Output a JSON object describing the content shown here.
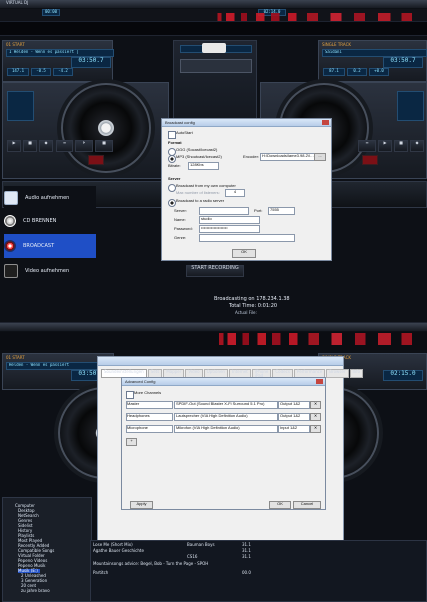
{
  "top": {
    "title_left": "VIRTUAL DJ",
    "time_a": "00:00",
    "time_b": "02:14.0",
    "search_hint": "search"
  },
  "deck_screen_1": {
    "left_deck": {
      "header": "01 START",
      "title": "1 Helden - Wenn es passiert |",
      "time": "03:50.7",
      "bpm": "147.1",
      "pitch": "-0.5",
      "gain": "-4.2",
      "deck_label": "1"
    },
    "right_deck": {
      "header": "SINGLE TRACK",
      "title": "Saidani",
      "time": "03:50.7",
      "bpm": "87.1",
      "pitch": "0.2",
      "gain": "+0.0",
      "deck_label": "2"
    },
    "center": {
      "broadcast_button": "START RECORDING",
      "broadcast_status": "Broadcasting on 178.234.1.38",
      "total_time_label": "Total Time: 0:01:20",
      "actual_file_label": "Actual File:",
      "menu_items": [
        {
          "label": "Audio aufnehmen",
          "icon": "cassette-icon"
        },
        {
          "label": "CD BRENNEN",
          "icon": "cd-icon"
        },
        {
          "label": "BROADCAST",
          "icon": "broadcast-icon"
        },
        {
          "label": "Video aufnehmen",
          "icon": "video-icon"
        }
      ]
    },
    "dialog": {
      "title": "Broadcast config",
      "autostart_label": "AutoStart",
      "format_label": "Format",
      "format_ogg": "OGG (Socast/Icecast2)",
      "format_mp3": "MP3 (Shoutcast/Icecast2)",
      "encoder_label": "Encoder:",
      "encoder_value": "H:\\Downloads\\lame3.98.2\\lame",
      "bitrate_label": "Bitrate:",
      "bitrate_value": "128Kbs",
      "server_label": "Server",
      "broadcast_own": "Broadcast from my own computer",
      "max_listeners_label": "Max number of listeners:",
      "max_listeners_value": "4",
      "broadcast_radio": "Broadcast to a radio server",
      "server_field_label": "Server:",
      "server_value": "",
      "port_label": "Port:",
      "port_value": "7555",
      "name_label": "Name:",
      "name_value": "studio",
      "password_label": "Password:",
      "password_value": "•••••••••••••••••••",
      "genre_label": "Genre:",
      "genre_value": "",
      "ok_button": "OK"
    }
  },
  "deck_screen_2": {
    "left_deck": {
      "header": "01 START",
      "title": "Helden - Wenn es passiert",
      "time": "03:50.7",
      "bpm": "143.1",
      "pitch": "-1.5",
      "gain": "-4.2"
    },
    "right_deck": {
      "header": "SINGLE TRACK",
      "title": "02:15.0",
      "time": "02:15.0",
      "bpm": "87.1",
      "pitch": "0.2",
      "gain": "+0.0"
    },
    "tabs": [
      "Soundeinstellungen",
      "Sets",
      "Mapper",
      "Video",
      "Optionen",
      "Internet",
      "iPhone iPad",
      "Codecs",
      "Performance",
      "Browser",
      "Info"
    ],
    "advanced_dialog": {
      "title": "Advanced Config",
      "more_channels": "More Channels",
      "rows": [
        {
          "role": "Master",
          "device": "SPDIF-Out (Sound Blaster X-Fi Surround 5.1 Pro)",
          "output": "Output 1&2"
        },
        {
          "role": "Headphones",
          "device": "Lautsprecher (VIA High Definition Audio)",
          "output": "Output 1&2"
        },
        {
          "role": "Microphone",
          "device": "Mikrofon (VIA High Definition Audio)",
          "output": "Input 1&2"
        }
      ],
      "add_button": "+",
      "apply_button": "Apply",
      "ok_button": "OK",
      "cancel_button": "Cancel",
      "outer_ok": "OK"
    },
    "browser": {
      "folders": [
        "Computer",
        "Desktop",
        "NetSearch",
        "Genres",
        "Sidelist",
        "History",
        "Playlists",
        "Most Played",
        "Recently Added",
        "Compatible Songs",
        "Virtual Folder",
        "Pepeno Videos",
        "Pepeno Musik",
        "Musik (E:)",
        "2 Unleashed",
        "3 Generation",
        "20 cent",
        "zu jahre bravo"
      ],
      "tracks": [
        {
          "title": "Lose Me (Short Mix)",
          "artist": "Bauman Boys",
          "bpm": "31.1"
        },
        {
          "title": "Agathe Bauer Geschichte",
          "artist": "",
          "bpm": "31.1"
        },
        {
          "title": "Mountain Boys",
          "artist": "CS16",
          "bpm": "31.1"
        }
      ],
      "status_line": "Mountainsongs advice: Begel, Bob - Turn the Page - SPOH",
      "footer_track": "Partitch",
      "footer_value": "00.0"
    }
  },
  "chart_colors": {
    "accent": "#cf1f2d",
    "lcd": "#0a2743",
    "dialog": "#f0f0f0"
  }
}
